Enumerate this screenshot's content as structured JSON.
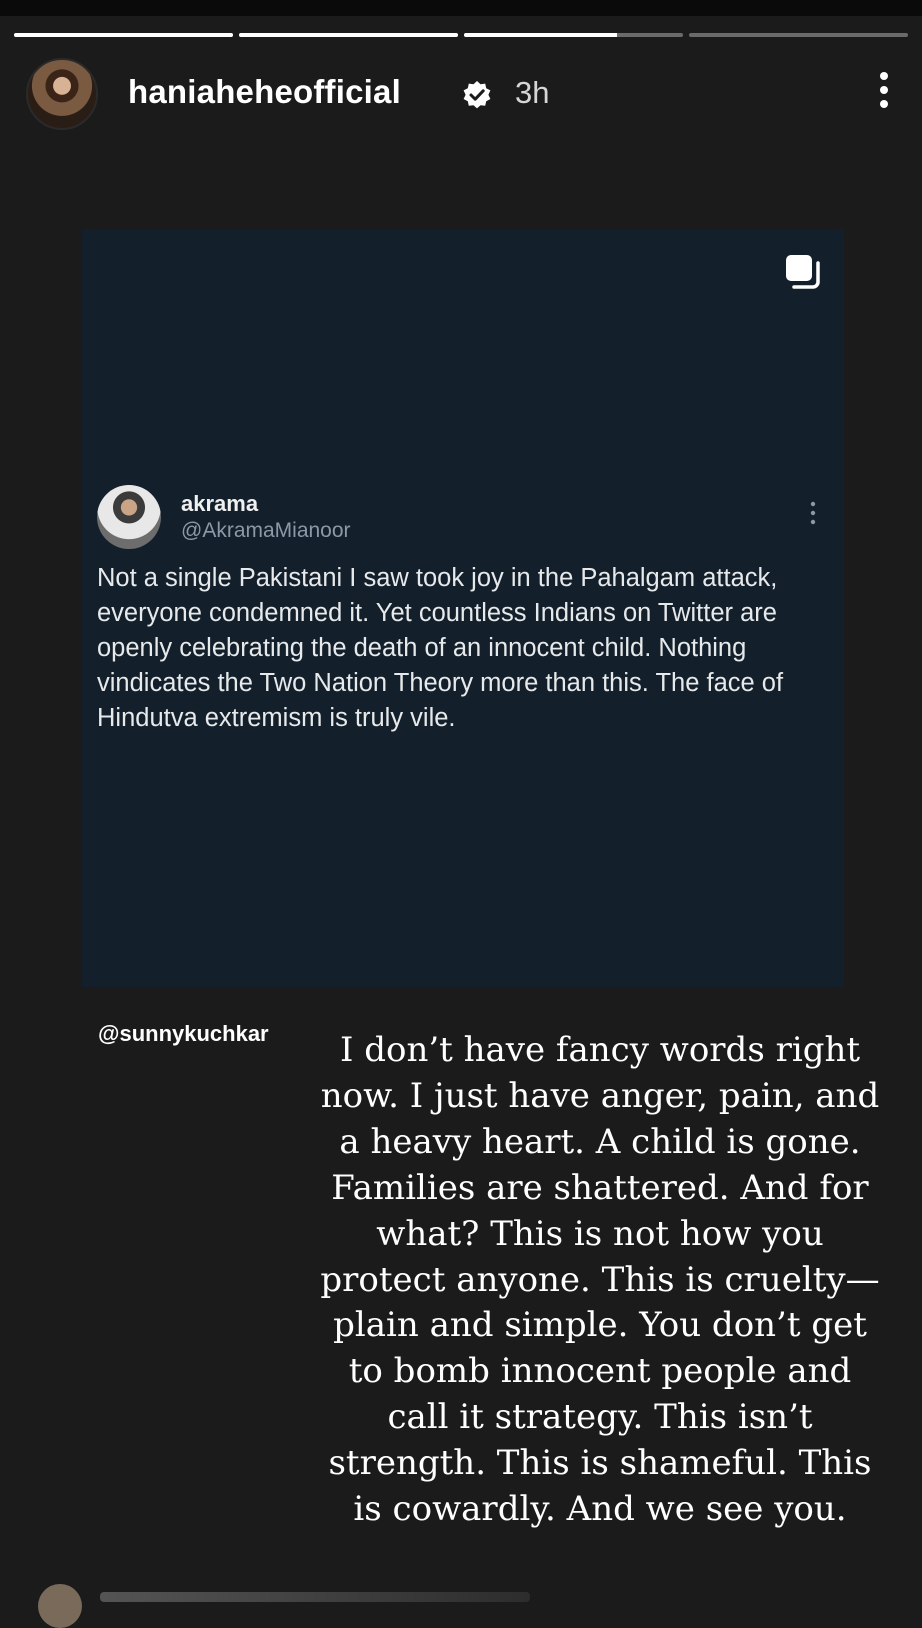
{
  "story": {
    "progress_segments": [
      1,
      1,
      0.7,
      0
    ]
  },
  "header": {
    "username": "haniaheheofficial",
    "time_ago": "3h",
    "verified_icon": "verified-badge-icon",
    "more_icon": "more-vertical-icon"
  },
  "tweet": {
    "name": "akrama",
    "handle": "@AkramaMianoor",
    "text": "Not a single Pakistani I saw took joy in the Pahalgam attack, everyone condemned it. Yet countless Indians on Twitter are openly celebrating the death of an innocent child. Nothing vindicates the Two Nation Theory more than this. The face of Hindutva extremism is truly vile.",
    "card_background": "#13202c"
  },
  "story_mention": "@sunnykuchkar",
  "caption": "I don’t have fancy words right now. I just have anger, pain, and a heavy heart. A child is gone. Families are shattered. And for what? This is not how you protect anyone. This is cruelty—plain and simple. You don’t get to bomb innocent people and call it strategy. This isn’t strength. This is shameful. This is cowardly. And we see you."
}
